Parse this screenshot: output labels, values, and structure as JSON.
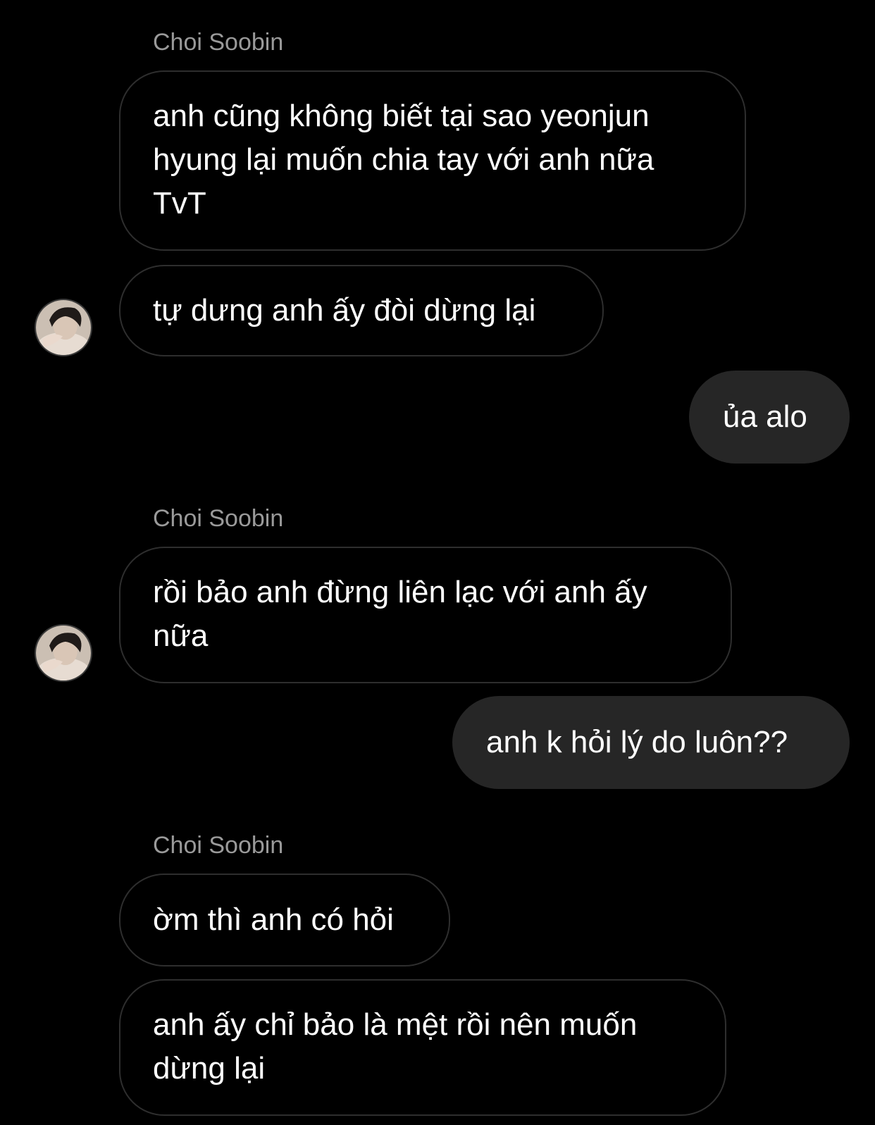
{
  "conversation": {
    "contact_name": "Choi Soobin",
    "groups": [
      {
        "sender_label": "Choi Soobin",
        "messages": [
          {
            "lines": [
              "anh cũng không biết tại sao yeonjun",
              "hyung lại muốn chia tay với anh nữa",
              "TvT"
            ]
          },
          {
            "lines": [
              "tự dưng anh ấy đòi dừng lại"
            ]
          }
        ]
      },
      {
        "outgoing": [
          {
            "lines": [
              "ủa alo"
            ]
          }
        ]
      },
      {
        "sender_label": "Choi Soobin",
        "messages": [
          {
            "lines": [
              "rồi bảo anh đừng liên lạc với anh ấy",
              "nữa"
            ]
          }
        ]
      },
      {
        "outgoing": [
          {
            "lines": [
              "anh k hỏi lý do luôn??"
            ]
          }
        ]
      },
      {
        "sender_label": "Choi Soobin",
        "messages": [
          {
            "lines": [
              "ờm thì anh có hỏi"
            ]
          },
          {
            "lines": [
              "anh ấy chỉ bảo là mệt rồi nên muốn",
              "dừng lại"
            ]
          }
        ]
      }
    ]
  },
  "colors": {
    "background": "#000000",
    "incoming_border": "#2e2e2e",
    "outgoing_fill": "#262626",
    "sender_label": "#9a9a9a",
    "text": "#ffffff"
  },
  "icons": {
    "avatar": "contact-avatar-photo"
  }
}
